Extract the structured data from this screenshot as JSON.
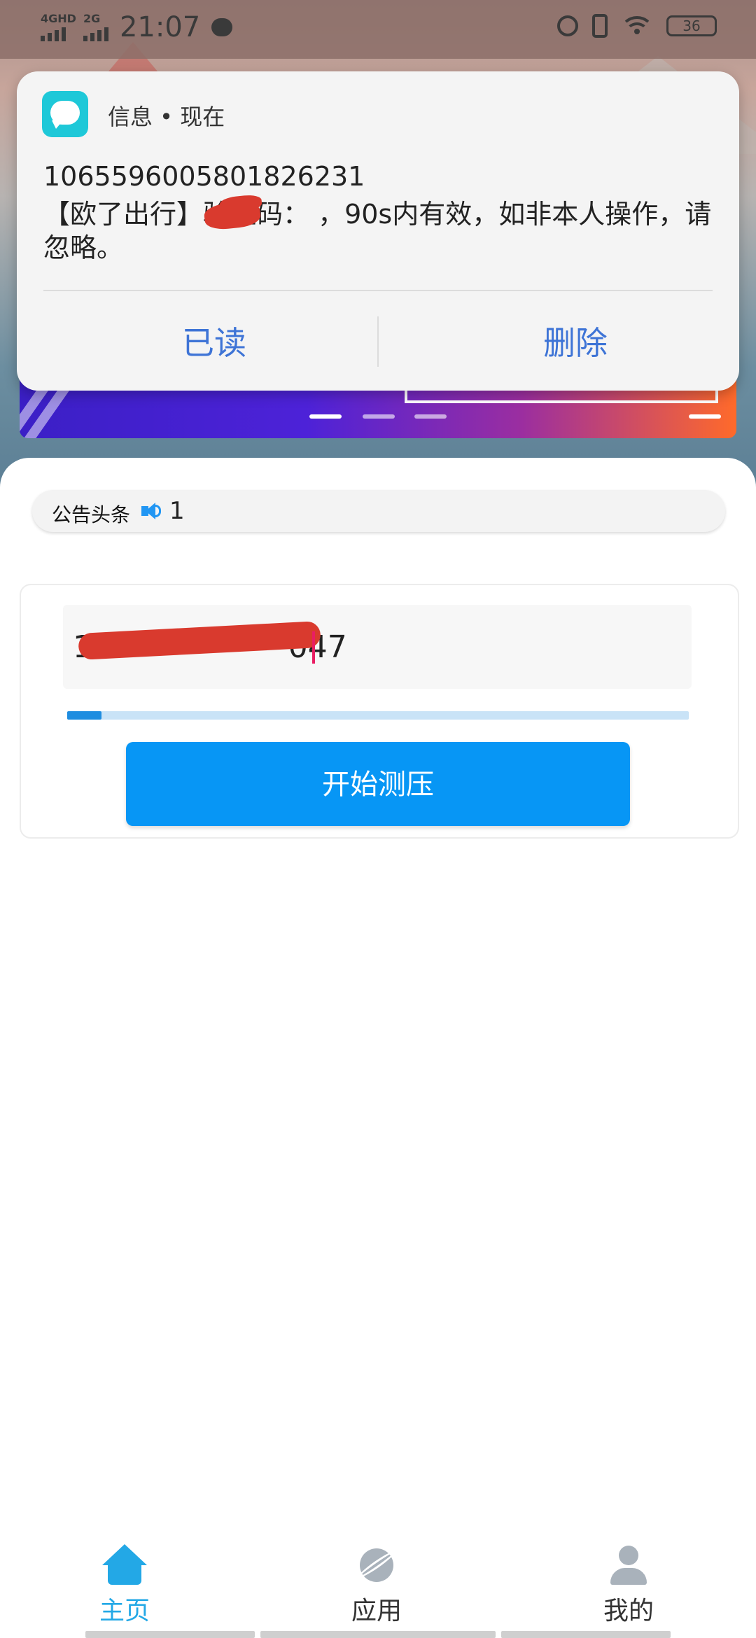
{
  "status_bar": {
    "network_1": "4GHD",
    "network_2": "2G",
    "time": "21:07",
    "battery": "36",
    "icons": [
      "message-icon",
      "alarm-icon",
      "vibrate-icon",
      "wifi-icon",
      "battery-icon"
    ]
  },
  "notification": {
    "app_name": "信息 • 现在",
    "sender": "1065596005801826231",
    "body": "【欧了出行】验证码：      ，90s内有效，如非本人操作，请忽略。",
    "actions": [
      "已读",
      "删除"
    ]
  },
  "announcement": {
    "label": "公告头条",
    "count": "1"
  },
  "form": {
    "phone_value": "17                  047",
    "progress_fraction": 0.055,
    "start_button": "开始测压"
  },
  "tabs": [
    {
      "label": "主页",
      "icon": "home-icon",
      "color": "#23a8e6"
    },
    {
      "label": "应用",
      "icon": "planet-icon",
      "color": "#333333"
    },
    {
      "label": "我的",
      "icon": "user-icon",
      "color": "#333333"
    }
  ],
  "colors": {
    "accent": "#0796f5",
    "tab_active": "#23a8e6",
    "notification_action": "#3e74d6",
    "redaction": "#d93a2e"
  }
}
